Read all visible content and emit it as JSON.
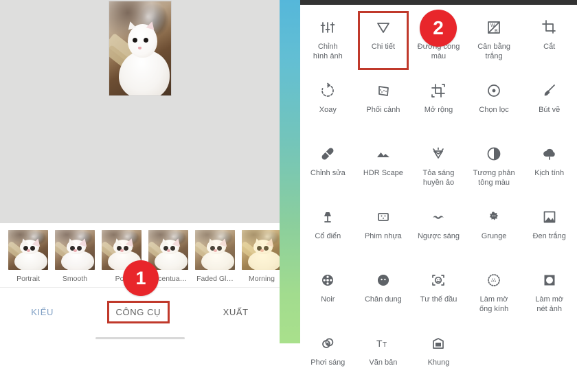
{
  "left": {
    "preview": {
      "name": "edited-photo-preview",
      "subject": "white cat photo"
    },
    "filters": [
      {
        "label": "Portrait",
        "tone": "t-portrait"
      },
      {
        "label": "Smooth",
        "tone": "t-smooth"
      },
      {
        "label": "Pop",
        "tone": "t-pop"
      },
      {
        "label": "Accentua…",
        "tone": "t-accent"
      },
      {
        "label": "Faded Gl…",
        "tone": "t-faded"
      },
      {
        "label": "Morning",
        "tone": "t-morning"
      }
    ],
    "tabs": [
      {
        "label": "KIỂU",
        "active": true,
        "boxed": false
      },
      {
        "label": "CÔNG CỤ",
        "active": false,
        "boxed": true
      },
      {
        "label": "XUẤT",
        "active": false,
        "boxed": false
      }
    ],
    "badge": "1"
  },
  "right": {
    "badge": "2",
    "tools": [
      {
        "label": "Chỉnh\nhình ảnh",
        "icon": "tune-icon",
        "boxed": false
      },
      {
        "label": "Chi tiết",
        "icon": "details-triangle-icon",
        "boxed": true
      },
      {
        "label": "Đường cong màu",
        "icon": "curves-icon",
        "boxed": false
      },
      {
        "label": "Cân bằng\ntrắng",
        "icon": "white-balance-icon",
        "boxed": false
      },
      {
        "label": "Cắt",
        "icon": "crop-icon",
        "boxed": false
      },
      {
        "label": "Xoay",
        "icon": "rotate-icon",
        "boxed": false
      },
      {
        "label": "Phối cảnh",
        "icon": "perspective-icon",
        "boxed": false
      },
      {
        "label": "Mở rộng",
        "icon": "expand-icon",
        "boxed": false
      },
      {
        "label": "Chọn lọc",
        "icon": "selective-icon",
        "boxed": false
      },
      {
        "label": "Bút vẽ",
        "icon": "brush-icon",
        "boxed": false
      },
      {
        "label": "Chỉnh sửa",
        "icon": "healing-icon",
        "boxed": false
      },
      {
        "label": "HDR Scape",
        "icon": "hdr-mountain-icon",
        "boxed": false
      },
      {
        "label": "Tỏa sáng\nhuyền ảo",
        "icon": "glamour-glow-icon",
        "boxed": false
      },
      {
        "label": "Tương phản\ntông màu",
        "icon": "tonal-contrast-icon",
        "boxed": false
      },
      {
        "label": "Kịch tính",
        "icon": "drama-cloud-icon",
        "boxed": false
      },
      {
        "label": "Cổ điển",
        "icon": "vintage-lamp-icon",
        "boxed": false
      },
      {
        "label": "Phim nhựa",
        "icon": "grainy-film-icon",
        "boxed": false
      },
      {
        "label": "Ngược sáng",
        "icon": "retrolux-icon",
        "boxed": false
      },
      {
        "label": "Grunge",
        "icon": "grunge-icon",
        "boxed": false
      },
      {
        "label": "Đen trắng",
        "icon": "black-white-icon",
        "boxed": false
      },
      {
        "label": "Noir",
        "icon": "noir-reel-icon",
        "boxed": false
      },
      {
        "label": "Chân dung",
        "icon": "portrait-face-icon",
        "boxed": false
      },
      {
        "label": "Tư thế đầu",
        "icon": "head-pose-icon",
        "boxed": false
      },
      {
        "label": "Làm mờ\nống kính",
        "icon": "lens-blur-icon",
        "boxed": false
      },
      {
        "label": "Làm mờ\nnét ảnh",
        "icon": "vignette-blur-icon",
        "boxed": false
      },
      {
        "label": "Phơi sáng",
        "icon": "double-exposure-icon",
        "boxed": false
      },
      {
        "label": "Văn bản",
        "icon": "text-icon",
        "boxed": false
      },
      {
        "label": "Khung",
        "icon": "frame-icon",
        "boxed": false
      }
    ]
  }
}
